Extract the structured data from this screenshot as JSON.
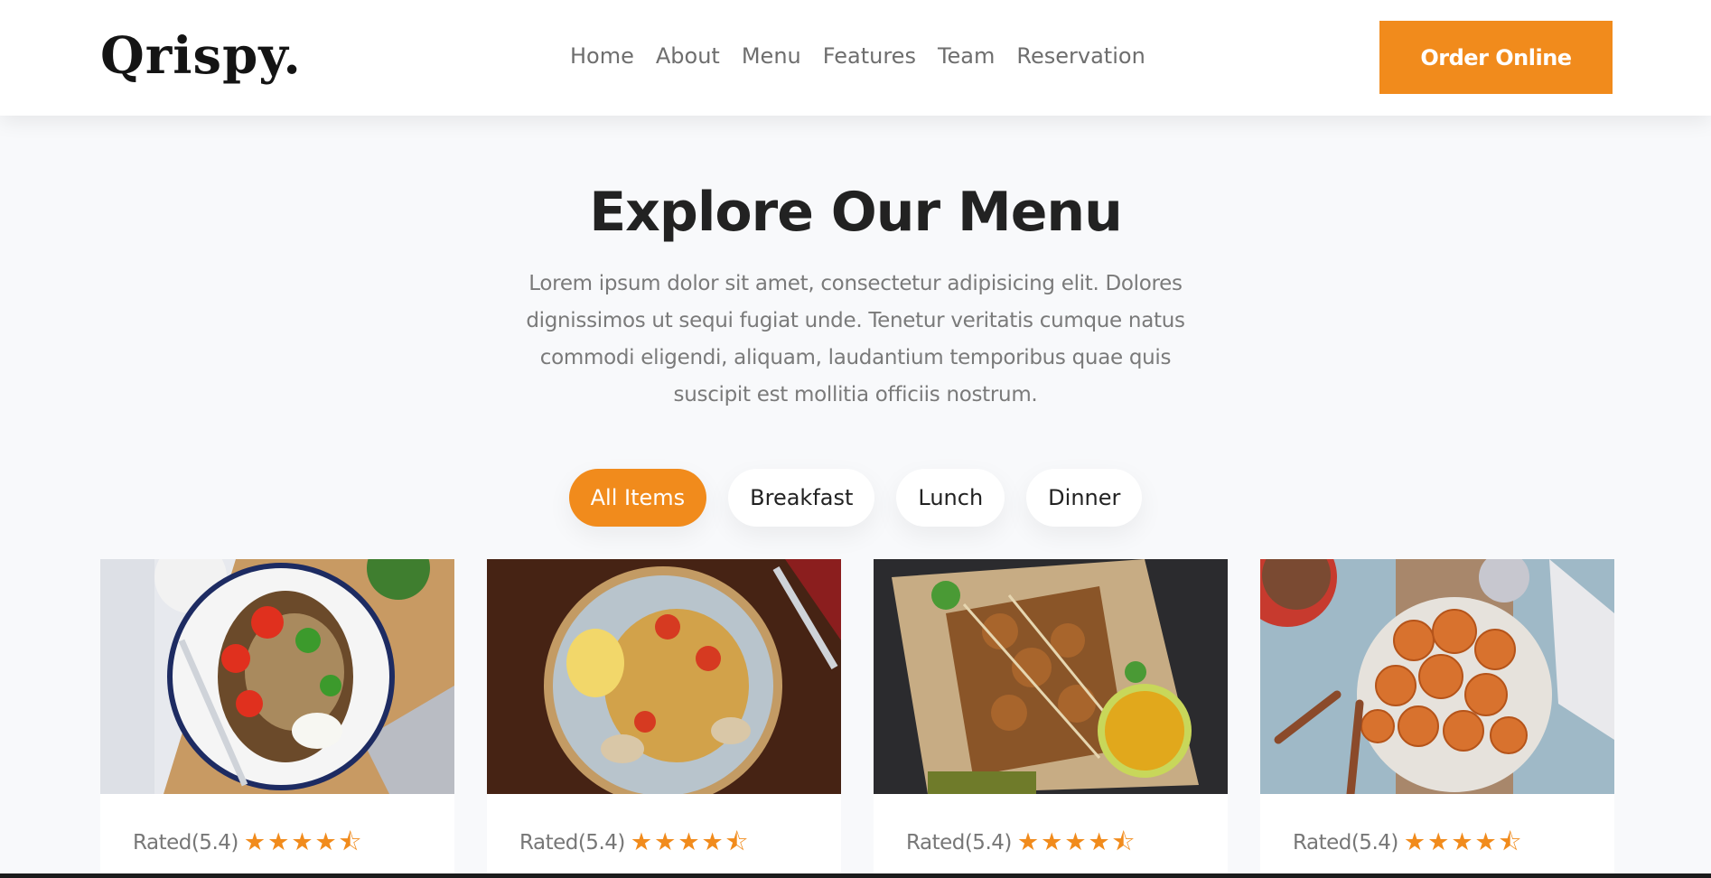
{
  "header": {
    "logo": "Qrispy.",
    "nav": [
      "Home",
      "About",
      "Menu",
      "Features",
      "Team",
      "Reservation"
    ],
    "order_button": "Order Online"
  },
  "menu": {
    "title": "Explore Our Menu",
    "description": "Lorem ipsum dolor sit amet, consectetur adipisicing elit. Dolores dignissimos ut sequi fugiat unde. Tenetur veritatis cumque natus commodi eligendi, aliquam, laudantium temporibus quae quis suscipit est mollitia officiis nostrum.",
    "filters": [
      {
        "label": "All Items",
        "active": true
      },
      {
        "label": "Breakfast",
        "active": false
      },
      {
        "label": "Lunch",
        "active": false
      },
      {
        "label": "Dinner",
        "active": false
      }
    ]
  },
  "cards": [
    {
      "rating_text": "Rated(5.4)",
      "stars": 4.5,
      "image_icon": "roasted-eggplant-salad-photo"
    },
    {
      "rating_text": "Rated(5.4)",
      "stars": 4.5,
      "image_icon": "seafood-pasta-photo"
    },
    {
      "rating_text": "Rated(5.4)",
      "stars": 4.5,
      "image_icon": "chicken-skewers-photo"
    },
    {
      "rating_text": "Rated(5.4)",
      "stars": 4.5,
      "image_icon": "sweet-potato-chips-photo"
    }
  ],
  "colors": {
    "accent": "#f18b1c",
    "background": "#f8f9fb",
    "heading": "#222222",
    "muted_text": "#7a7a7a"
  }
}
